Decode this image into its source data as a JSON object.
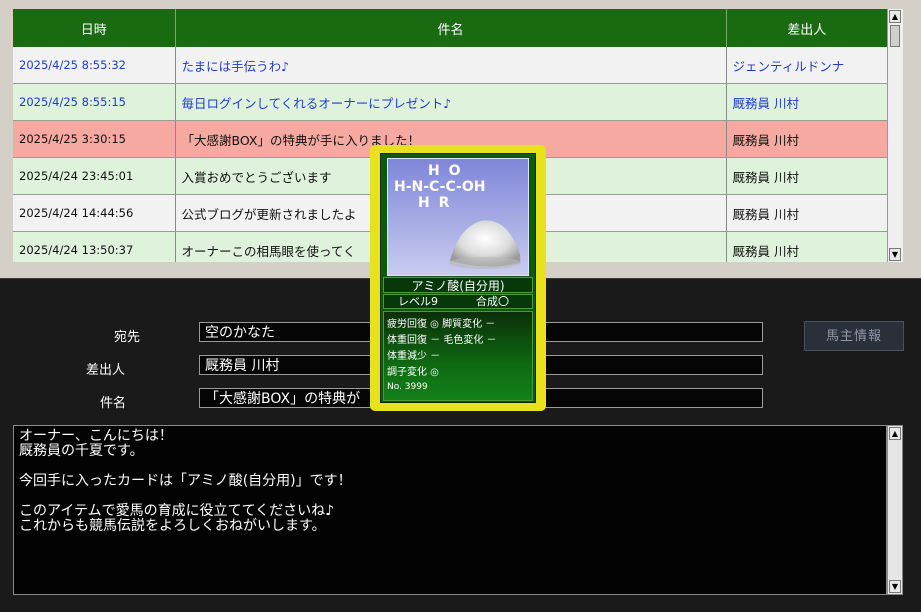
{
  "mail_list": {
    "headers": {
      "date": "日時",
      "subject": "件名",
      "sender": "差出人"
    },
    "rows": [
      {
        "date": "2025/4/25 8:55:32",
        "subject": "たまには手伝うわ♪",
        "sender": "ジェンティルドンナ"
      },
      {
        "date": "2025/4/25 8:55:15",
        "subject": "毎日ログインしてくれるオーナーにプレゼント♪",
        "sender": "厩務員 川村"
      },
      {
        "date": "2025/4/25 3:30:15",
        "subject": "「大感謝BOX」の特典が手に入りました！",
        "sender": "厩務員 川村"
      },
      {
        "date": "2025/4/24 23:45:01",
        "subject": "入賞おめでとうございます",
        "sender": "厩務員 川村"
      },
      {
        "date": "2025/4/24 14:44:56",
        "subject": "公式ブログが更新されましたよ",
        "sender": "厩務員 川村"
      },
      {
        "date": "2025/4/24 13:50:37",
        "subject": "オーナーこの相馬眼を使ってく",
        "sender": "厩務員 川村"
      }
    ]
  },
  "detail": {
    "to_label": "宛先",
    "to_value": "空のかなた",
    "from_label": "差出人",
    "from_value": "厩務員 川村",
    "subject_label": "件名",
    "subject_value": "「大感謝BOX」の特典が",
    "owner_button": "馬主情報",
    "body_lines": [
      "オーナー、こんにちは！",
      "厩務員の千夏です。",
      "",
      "今回手に入ったカードは「アミノ酸(自分用)」です！",
      "",
      "このアイテムで愛馬の育成に役立ててくださいね♪",
      "これからも競馬伝説をよろしくおねがいします。"
    ]
  },
  "card": {
    "formula_top": "H O",
    "formula_mid": "H-N-C-C-OH",
    "formula_bottom": "H R",
    "name": "アミノ酸(自分用)",
    "level": "レベル9",
    "synthesis": "合成〇",
    "stats": [
      "疲労回復 ◎ 脚質変化 －",
      "体重回復 － 毛色変化 －",
      "体重減少 －",
      "調子変化 ◎"
    ],
    "number": "No. 3999"
  },
  "colors": {
    "header_green": "#1a6a12",
    "unread_blue": "#1f3ccc",
    "row_red": "#f5a9a0",
    "row_green": "#dff2dc",
    "card_gold": "#e8e21c"
  }
}
